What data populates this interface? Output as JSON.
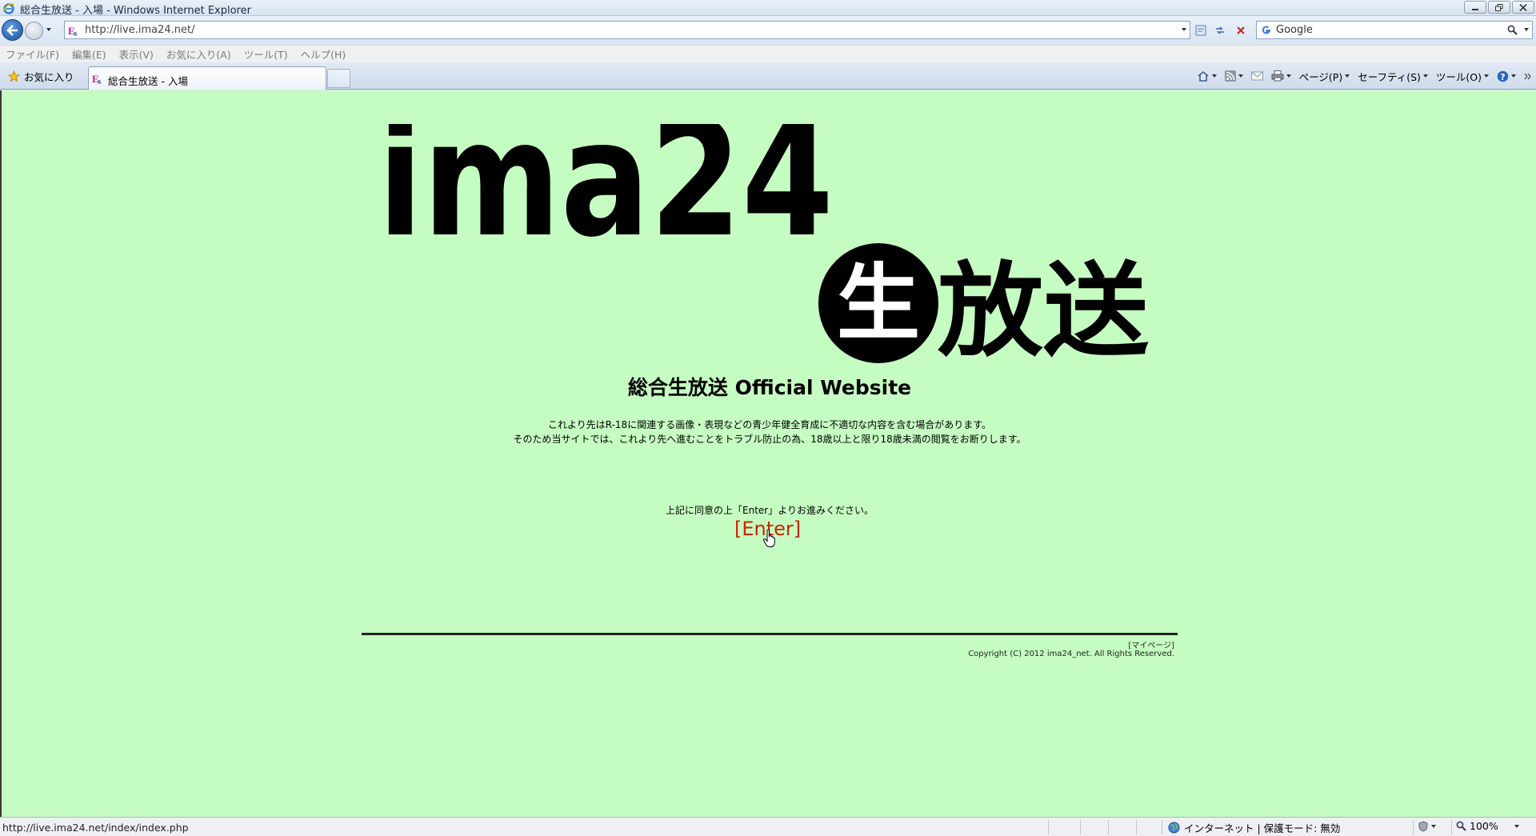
{
  "window": {
    "title": "総合生放送 - 入場 - Windows Internet Explorer"
  },
  "address_bar": {
    "url": "http://live.ima24.net/",
    "search_engine": "Google"
  },
  "menu": {
    "items": [
      "ファイル(F)",
      "編集(E)",
      "表示(V)",
      "お気に入り(A)",
      "ツール(T)",
      "ヘルプ(H)"
    ]
  },
  "tabs": {
    "favorites_label": "お気に入り",
    "active_tab": "総合生放送 - 入場"
  },
  "command_bar": {
    "page": "ページ(P)",
    "safety": "セーフティ(S)",
    "tools": "ツール(O)"
  },
  "page": {
    "logo_text": "ima24",
    "logo_nama": "生",
    "logo_housou": "放送",
    "site_title": "総合生放送 Official Website",
    "warning_line1": "これより先はR-18に関連する画像・表現などの青少年健全育成に不適切な内容を含む場合があります。",
    "warning_line2": "そのため当サイトでは、これより先へ進むことをトラブル防止の為、18歳以上と限り18歳未満の閲覧をお断りします。",
    "agree_text": "上記に同意の上「Enter」よりお進みください。",
    "enter_link": "[Enter]",
    "mypage_link": "[マイページ]",
    "copyright": "Copyright (C) 2012 ima24_net. All Rights Reserved."
  },
  "status_bar": {
    "link_url": "http://live.ima24.net/index/index.php",
    "zone": "インターネット | 保護モード: 無効",
    "zoom": "100%"
  },
  "colors": {
    "page_background": "#c5fcc1",
    "enter_link": "#cc2200"
  }
}
